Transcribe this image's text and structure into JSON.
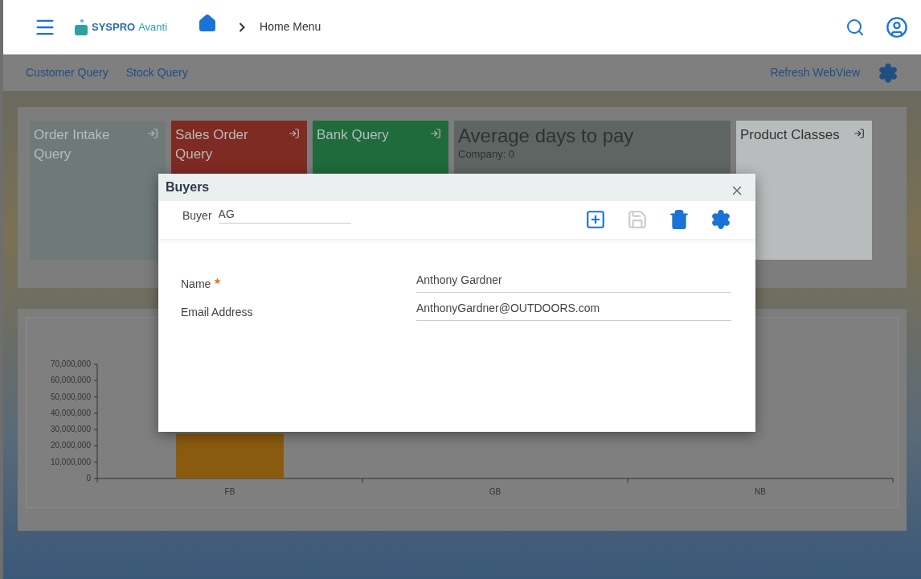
{
  "header": {
    "logo": "SYSPRO",
    "logo_suffix": "Avanti",
    "breadcrumb": "Home Menu"
  },
  "toolbar": {
    "links": [
      "Customer Query",
      "Stock Query"
    ],
    "right_link": "Refresh WebView"
  },
  "tiles": [
    {
      "title": "Order Intake Query",
      "color": "#6f7a78",
      "kind": "query"
    },
    {
      "title": "Sales Order Query",
      "color": "#7f2a22",
      "kind": "query"
    },
    {
      "title": "Bank Query",
      "color": "#1f6b3c",
      "kind": "query"
    },
    {
      "title": "Average days to pay",
      "subtitle": "Company: 0",
      "color": "#5f6563",
      "kind": "metric"
    },
    {
      "title": "Product Classes",
      "color": "#b9bcbc",
      "kind": "query"
    }
  ],
  "chart": {
    "chart_data": {
      "type": "bar",
      "categories": [
        "FB",
        "GB",
        "NB"
      ],
      "series": [
        {
          "color": "#8a5a10",
          "values": [
            27500000,
            0,
            0
          ]
        }
      ],
      "ylim": [
        0,
        70000000
      ],
      "yticks": [
        {
          "value": 0,
          "label": "0"
        },
        {
          "value": 10000000,
          "label": "10,000,000"
        },
        {
          "value": 20000000,
          "label": "20,000,000"
        },
        {
          "value": 30000000,
          "label": "30,000,000"
        },
        {
          "value": 40000000,
          "label": "40,000,000"
        },
        {
          "value": 50000000,
          "label": "50,000,000"
        },
        {
          "value": 60000000,
          "label": "60,000,000"
        },
        {
          "value": 70000000,
          "label": "70,000,000"
        }
      ]
    }
  },
  "dialog": {
    "title": "Buyers",
    "key_label": "Buyer",
    "key_value": "AG",
    "actions": [
      {
        "kind": "add",
        "disabled": false
      },
      {
        "kind": "save",
        "disabled": true
      },
      {
        "kind": "delete",
        "disabled": false
      },
      {
        "kind": "settings",
        "disabled": false
      }
    ],
    "fields": [
      {
        "label": "Name",
        "required": true,
        "value": "Anthony Gardner"
      },
      {
        "label": "Email Address",
        "required": false,
        "value": "AnthonyGardner@OUTDOORS.com"
      }
    ]
  }
}
